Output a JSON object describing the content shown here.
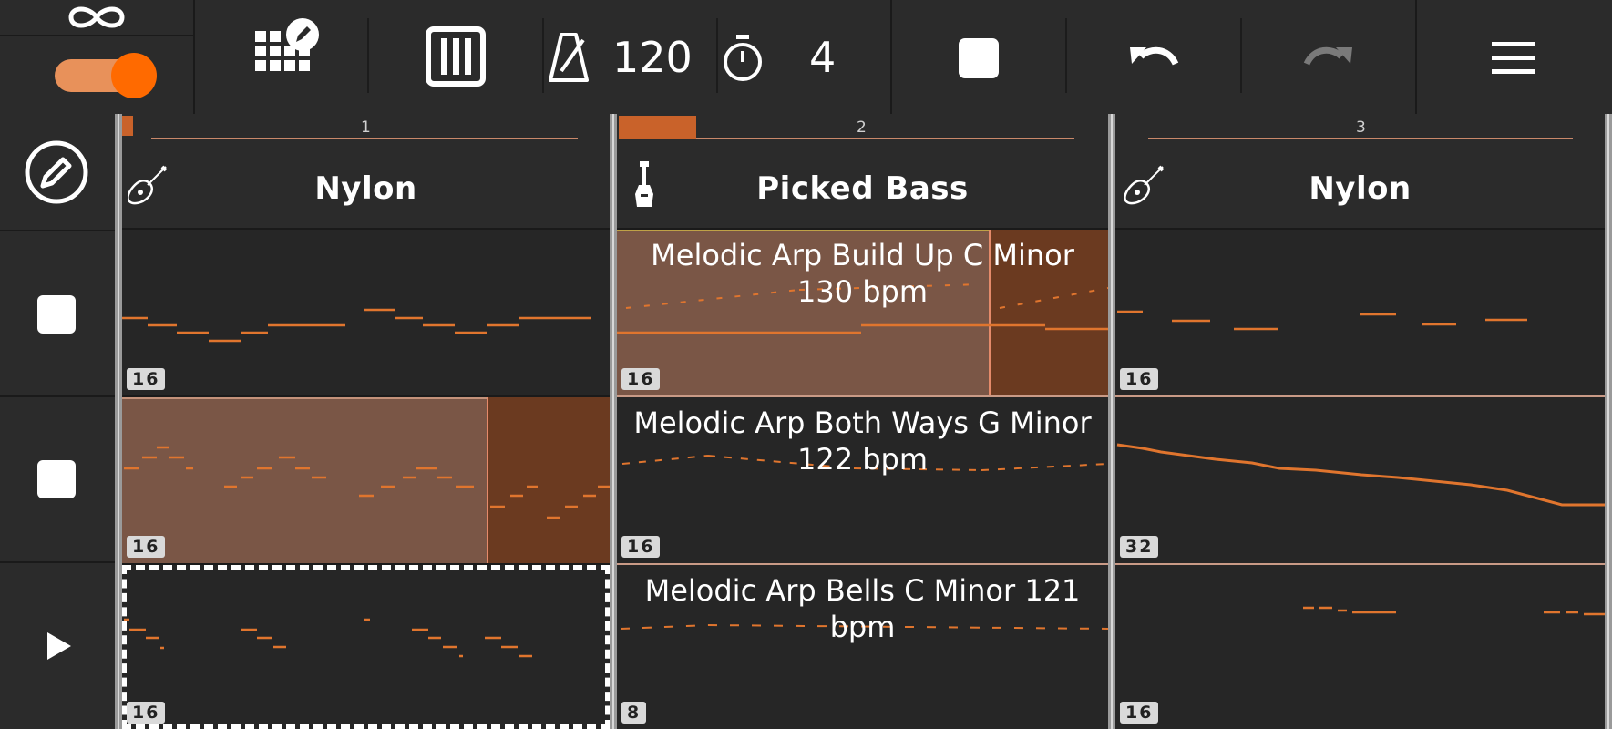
{
  "toolbar": {
    "tempo": "120",
    "countdown": "4",
    "icons": [
      "loop-icon",
      "pad-edit-icon",
      "mixer-icon",
      "metronome-icon",
      "timer-icon",
      "stop-icon",
      "undo-icon",
      "redo-icon",
      "menu-icon"
    ],
    "loop_enabled": true,
    "accent": "#ff6a00"
  },
  "rows": {
    "controls": [
      "stop",
      "stop",
      "play"
    ]
  },
  "columns": [
    {
      "number": "1",
      "instrument": "Nylon",
      "instrument_icon": "acoustic-guitar-icon",
      "clips": [
        {
          "name": "",
          "length": "16"
        },
        {
          "name": "",
          "length": "16"
        },
        {
          "name": "",
          "length": "16"
        }
      ]
    },
    {
      "number": "2",
      "instrument": "Picked Bass",
      "instrument_icon": "electric-guitar-icon",
      "clips": [
        {
          "name": "Melodic Arp Build Up C Minor 130 bpm",
          "length": "16"
        },
        {
          "name": "Melodic Arp Both Ways G Minor 122 bpm",
          "length": "16"
        },
        {
          "name": "Melodic Arp Bells C Minor 121 bpm",
          "length": "8"
        }
      ]
    },
    {
      "number": "3",
      "instrument": "Nylon",
      "instrument_icon": "acoustic-guitar-icon",
      "clips": [
        {
          "name": "",
          "length": "16"
        },
        {
          "name": "",
          "length": "32"
        },
        {
          "name": "",
          "length": "16"
        }
      ]
    }
  ],
  "colors": {
    "note": "#e0752e",
    "active_clip": "#7a5646",
    "background": "#2b2b2b"
  }
}
